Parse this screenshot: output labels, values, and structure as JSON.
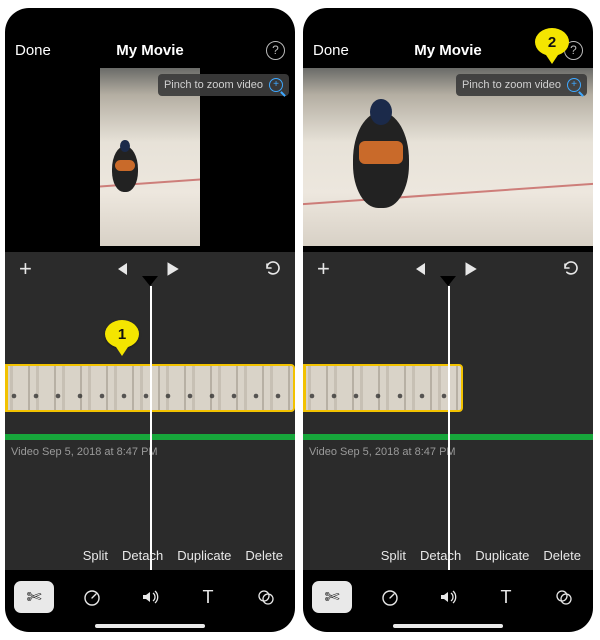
{
  "header": {
    "done": "Done",
    "title": "My Movie",
    "help_glyph": "?"
  },
  "preview": {
    "pinch_hint": "Pinch to zoom video"
  },
  "transport": {
    "add_glyph": "+"
  },
  "timeline": {
    "clip_meta": "Video Sep 5, 2018 at 8:47 PM"
  },
  "clip_actions": {
    "split": "Split",
    "detach": "Detach",
    "duplicate": "Duplicate",
    "delete": "Delete"
  },
  "toolbar": {
    "scissors_glyph": "✄",
    "text_glyph": "T"
  },
  "callouts": {
    "one": "1",
    "two": "2"
  }
}
